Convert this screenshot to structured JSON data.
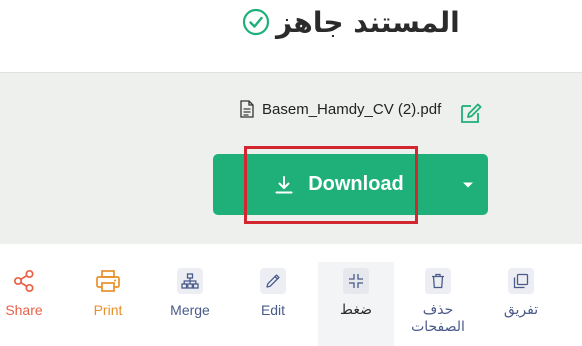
{
  "header": {
    "title": "المستند جاهز",
    "status_icon": "check-circle-icon",
    "accent": "#1fb07a"
  },
  "file": {
    "name": "Basem_Hamdy_CV (2).pdf",
    "file_icon": "document-icon",
    "edit_icon": "edit-filename-icon"
  },
  "download": {
    "label": "Download",
    "icon": "download-icon",
    "dropdown_icon": "caret-down-icon",
    "color": "#1fb07a",
    "highlight_color": "#d3262f"
  },
  "tools": [
    {
      "label": "Share",
      "icon": "share-icon",
      "color": "#e8624a"
    },
    {
      "label": "Print",
      "icon": "print-icon",
      "color": "#e8902a"
    },
    {
      "label": "Merge",
      "icon": "merge-icon",
      "color": "#4a5a8a"
    },
    {
      "label": "Edit",
      "icon": "pencil-icon",
      "color": "#4a5a8a"
    },
    {
      "label": "ضغط",
      "icon": "compress-icon",
      "color": "#2b2b2b"
    },
    {
      "label": "حذف الصفحات",
      "icon": "trash-icon",
      "color": "#4a5a8a"
    },
    {
      "label": "تفريق",
      "icon": "split-icon",
      "color": "#4a5a8a"
    }
  ]
}
